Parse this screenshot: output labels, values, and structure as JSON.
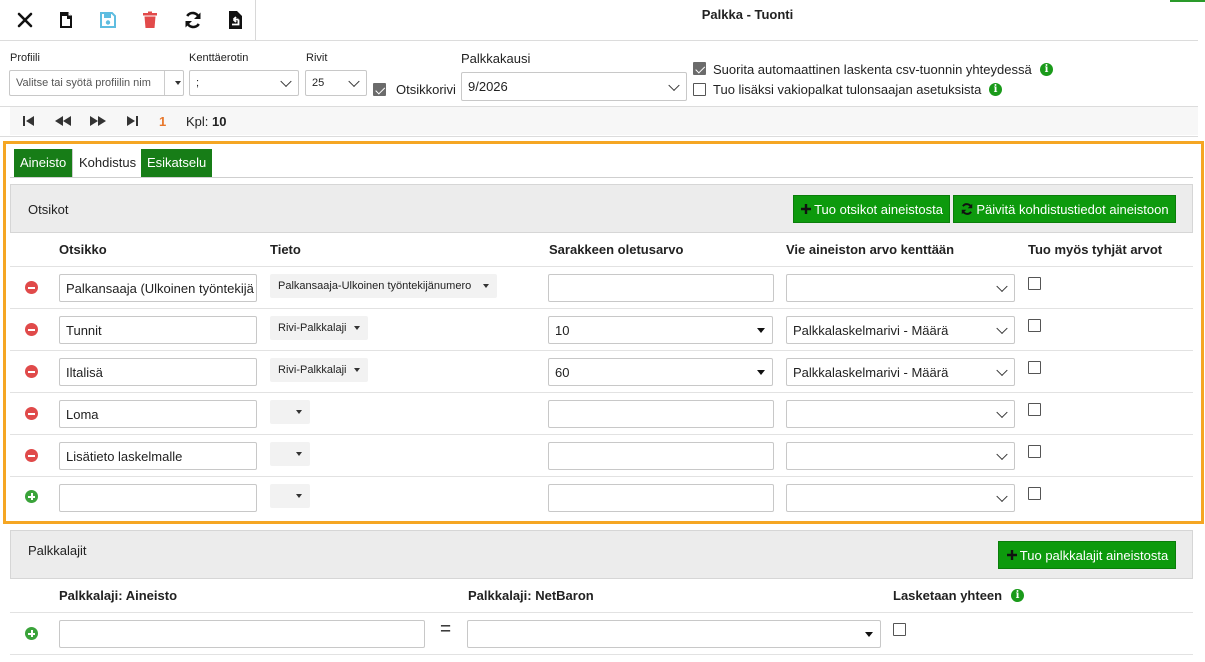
{
  "window": {
    "title": "Palkka - Tuonti"
  },
  "toolbar": {
    "icons": [
      "close-icon",
      "new-file-icon",
      "save-icon",
      "delete-icon",
      "refresh-icon",
      "import-icon"
    ]
  },
  "settings": {
    "profile_label": "Profiili",
    "profile_placeholder": "Valitse tai syötä profiilin nim",
    "separator_label": "Kenttäerotin",
    "separator_value": ";",
    "rows_label": "Rivit",
    "rows_value": "25",
    "header_row_label": "Otsikkorivi",
    "header_row_checked": true,
    "period_label": "Palkkakausi",
    "period_value": "9/2026",
    "auto_calc_label": "Suorita automaattinen laskenta csv-tuonnin yhteydessä",
    "auto_calc_checked": true,
    "default_pay_label": "Tuo lisäksi vakiopalkat tulonsaajan asetuksista",
    "default_pay_checked": false
  },
  "pager": {
    "current_page": "1",
    "count_label": "Kpl:",
    "count_value": "10"
  },
  "tabs": [
    {
      "label": "Aineisto",
      "active": false
    },
    {
      "label": "Kohdistus",
      "active": true
    },
    {
      "label": "Esikatselu",
      "active": false
    }
  ],
  "headers_panel": {
    "title": "Otsikot",
    "import_button": "Tuo otsikot aineistosta",
    "update_button": "Päivitä kohdistustiedot aineistoon",
    "columns": [
      "Otsikko",
      "Tieto",
      "Sarakkeen oletusarvo",
      "Vie aineiston arvo kenttään",
      "Tuo myös tyhjät arvot"
    ],
    "rows": [
      {
        "otsikko": "Palkansaaja (Ulkoinen työntekijä",
        "tieto": "Palkansaaja-Ulkoinen työntekijänumero",
        "default": "",
        "target": "",
        "empty": false
      },
      {
        "otsikko": "Tunnit",
        "tieto": "Rivi-Palkkalaji",
        "default": "10",
        "target": "Palkkalaskelmarivi - Määrä",
        "empty": false
      },
      {
        "otsikko": "Iltalisä",
        "tieto": "Rivi-Palkkalaji",
        "default": "60",
        "target": "Palkkalaskelmarivi - Määrä",
        "empty": false
      },
      {
        "otsikko": "Loma",
        "tieto": "",
        "default": "",
        "target": "",
        "empty": false
      },
      {
        "otsikko": "Lisätieto laskelmalle",
        "tieto": "",
        "default": "",
        "target": "",
        "empty": false
      },
      {
        "otsikko": "",
        "tieto": "",
        "default": "",
        "target": "",
        "empty": false
      }
    ]
  },
  "pay_types_panel": {
    "title": "Palkkalajit",
    "import_button": "Tuo palkkalajit aineistosta",
    "col_source": "Palkkalaji: Aineisto",
    "col_target": "Palkkalaji: NetBaron",
    "col_sum": "Lasketaan yhteen",
    "equals": "=",
    "row": {
      "source": "",
      "target": "",
      "sum": false
    }
  },
  "colors": {
    "accent_green": "#177d17",
    "button_green": "#0d9a0d",
    "highlight_orange": "#f5a623",
    "counter_orange": "#e8782c"
  }
}
